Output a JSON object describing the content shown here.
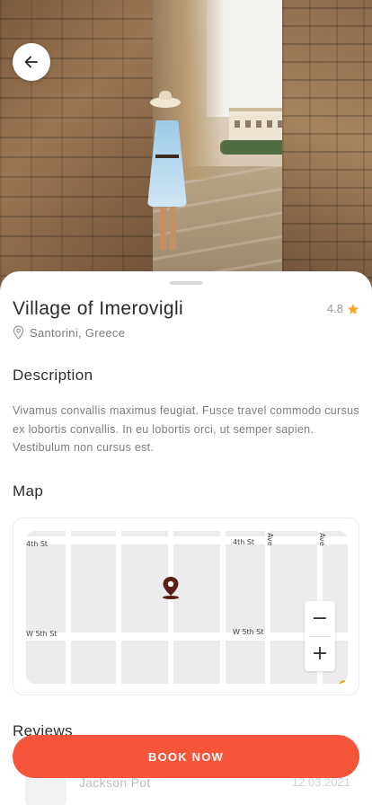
{
  "place": {
    "title": "Village of Imerovigli",
    "rating": "4.8",
    "location": "Santorini, Greece"
  },
  "description": {
    "heading": "Description",
    "text": "Vivamus convallis maximus feugiat. Fusce travel commodo cursus ex lobortis convallis. In eu lobortis orci, ut semper sapien. Vestibulum non cursus est."
  },
  "map": {
    "heading": "Map",
    "streets": [
      "4th St",
      "4th St",
      "W 5th St",
      "W 5th St",
      "Ave",
      "Ave"
    ],
    "zoom_out": "−",
    "zoom_in": "+"
  },
  "reviews": {
    "heading": "Reviews",
    "items": [
      {
        "name": "Jackson Pot",
        "date": "12.03.2021"
      }
    ]
  },
  "cta": {
    "label": "BOOK NOW"
  },
  "colors": {
    "accent": "#f7553a",
    "star": "#f5a623",
    "pin": "#5a1f17"
  },
  "icons": {
    "back": "arrow-left-icon",
    "star": "star-icon",
    "location": "location-pin-icon",
    "map_pin": "map-marker-icon"
  }
}
